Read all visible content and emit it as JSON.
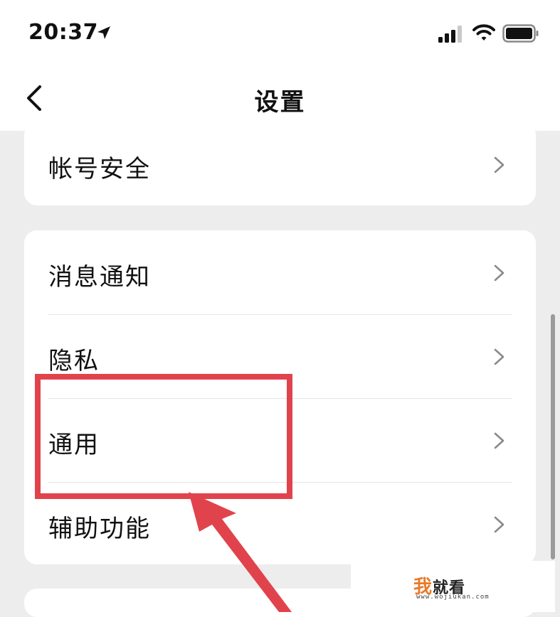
{
  "status_bar": {
    "time": "20:37",
    "icons": [
      "location-arrow-icon",
      "cellular-signal-icon",
      "wifi-icon",
      "battery-icon"
    ]
  },
  "nav": {
    "title": "设置",
    "back_icon": "chevron-left-icon"
  },
  "groups": [
    {
      "items": [
        {
          "label": "帐号安全"
        }
      ]
    },
    {
      "items": [
        {
          "label": "消息通知"
        },
        {
          "label": "隐私"
        },
        {
          "label": "通用"
        },
        {
          "label": "辅助功能"
        }
      ]
    }
  ],
  "annotation": {
    "color": "#e1434c",
    "highlighted_item": "通用"
  },
  "watermark": {
    "brand_first": "我",
    "brand_rest": "就看",
    "url": "www.wojiukan.com"
  }
}
